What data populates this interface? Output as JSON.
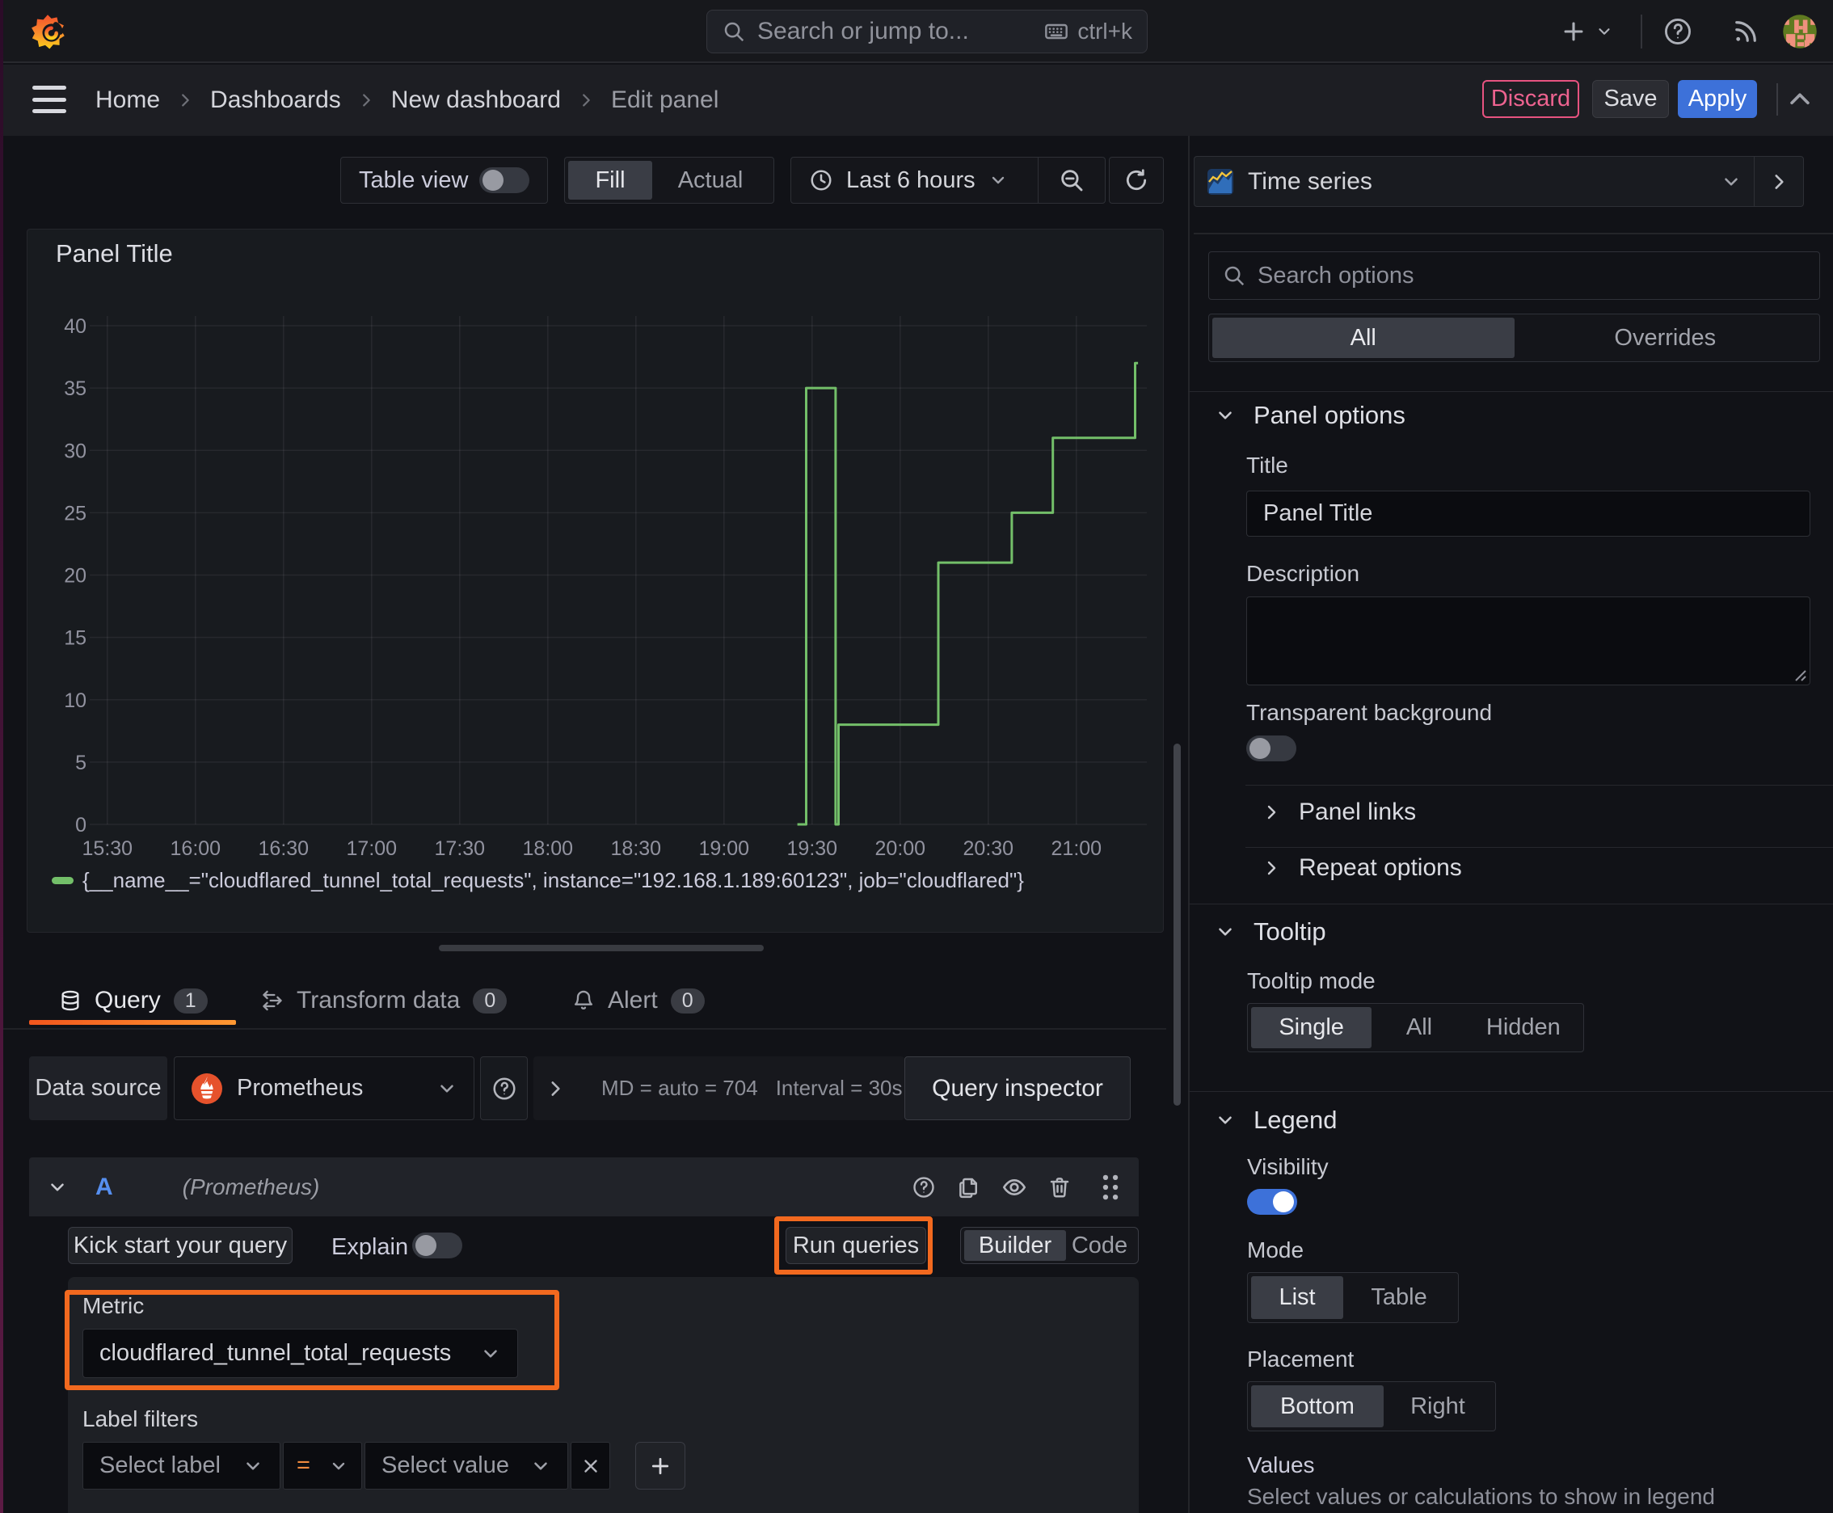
{
  "topbar": {
    "search_placeholder": "Search or jump to...",
    "shortcut": "ctrl+k"
  },
  "breadcrumbs": {
    "items": [
      "Home",
      "Dashboards",
      "New dashboard"
    ],
    "current": "Edit panel"
  },
  "actions": {
    "discard": "Discard",
    "save": "Save",
    "apply": "Apply"
  },
  "toolbar": {
    "table_view": "Table view",
    "fill": "Fill",
    "actual": "Actual",
    "time_range": "Last 6 hours"
  },
  "viz_picker": {
    "label": "Time series"
  },
  "panel": {
    "title": "Panel Title"
  },
  "chart_data": {
    "type": "line",
    "line_style": "step-after",
    "title": "Panel Title",
    "x_range": [
      "15:24",
      "21:24"
    ],
    "x_ticks": [
      "15:30",
      "16:00",
      "16:30",
      "17:00",
      "17:30",
      "18:00",
      "18:30",
      "19:00",
      "19:30",
      "20:00",
      "20:30",
      "21:00"
    ],
    "ylim": [
      0,
      40
    ],
    "y_ticks": [
      0,
      5,
      10,
      15,
      20,
      25,
      30,
      35,
      40
    ],
    "grid": true,
    "legend_position": "bottom",
    "series": [
      {
        "name": "{__name__=\"cloudflared_tunnel_total_requests\", instance=\"192.168.1.189:60123\", job=\"cloudflared\"}",
        "color": "#73bf69",
        "points": [
          [
            "19:25",
            0
          ],
          [
            "19:28",
            35
          ],
          [
            "19:38",
            0
          ],
          [
            "19:39",
            8
          ],
          [
            "20:13",
            21
          ],
          [
            "20:38",
            25
          ],
          [
            "20:52",
            31
          ],
          [
            "21:20",
            37
          ]
        ],
        "end": "21:21"
      }
    ]
  },
  "tabs": {
    "query": "Query",
    "query_count": "1",
    "transform": "Transform data",
    "transform_count": "0",
    "alert": "Alert",
    "alert_count": "0"
  },
  "datasource_row": {
    "label": "Data source",
    "datasource": "Prometheus",
    "stat_md": "MD = auto = 704",
    "stat_interval": "Interval = 30s",
    "inspector": "Query inspector"
  },
  "query_editor": {
    "ref_id": "A",
    "ds_hint": "(Prometheus)",
    "kick_start": "Kick start your query",
    "explain": "Explain",
    "run_queries": "Run queries",
    "builder": "Builder",
    "code": "Code",
    "metric_label": "Metric",
    "metric_value": "cloudflared_tunnel_total_requests",
    "label_filters": "Label filters",
    "select_label": "Select label",
    "operator": "=",
    "select_value": "Select value"
  },
  "options": {
    "search_placeholder": "Search options",
    "tab_all": "All",
    "tab_overrides": "Overrides",
    "panel_options": {
      "title": "Panel options",
      "title_label": "Title",
      "title_value": "Panel Title",
      "description_label": "Description",
      "transparent": "Transparent background",
      "links": "Panel links",
      "repeat": "Repeat options"
    },
    "tooltip": {
      "title": "Tooltip",
      "mode_label": "Tooltip mode",
      "modes": [
        "Single",
        "All",
        "Hidden"
      ]
    },
    "legend": {
      "title": "Legend",
      "visibility": "Visibility",
      "mode_label": "Mode",
      "modes": [
        "List",
        "Table"
      ],
      "placement_label": "Placement",
      "placements": [
        "Bottom",
        "Right"
      ],
      "values_label": "Values",
      "values_hint": "Select values or calculations to show in legend"
    }
  },
  "colors": {
    "accent_blue": "#3d71d9",
    "accent_orange": "#ff9832",
    "annotation_orange": "#f2691f",
    "series_green": "#73bf69",
    "discard_pink": "#e75380"
  }
}
